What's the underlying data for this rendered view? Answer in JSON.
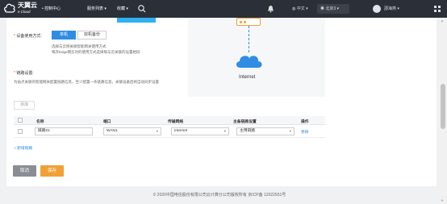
{
  "header": {
    "brand": "天翼云",
    "brand_sub": "e Cloud",
    "console": "控制中心",
    "services": "服务列表",
    "favorites": "收藏",
    "language": "中文",
    "region": "北京3",
    "username": "邵海燕"
  },
  "form": {
    "mode_label": "设备使用方式:",
    "mode_options": [
      "单机",
      "双机备份"
    ],
    "mode_selected": "单机",
    "mode_help_1": "选择与云侧关联智能网关使用方式",
    "mode_help_2": "每开Edge网云对的使用方式选择每与云关联的设置相同",
    "link_label": "链路设置:",
    "link_help": "为站点关联的智能网关配置链路信息，至少配置一条链路信息，关联设备后将自动同步设置"
  },
  "topology": {
    "internet_label": "Internet"
  },
  "table": {
    "add_button": "添加",
    "columns": [
      "名称",
      "端口",
      "传输网络",
      "主备链路设置",
      "操作"
    ],
    "rows": [
      {
        "name": "链路01",
        "port": "WAN1",
        "network": "Internet",
        "role": "主用链路",
        "action": "移除"
      }
    ],
    "new_link": "+ 新增链路"
  },
  "actions": {
    "cancel": "取消",
    "save": "保存"
  },
  "footer": {
    "copyright": "© 2020中国电信股份有限公司云计算分公司版权所有 京ICP备 12022551号"
  },
  "colors": {
    "accent": "#2f8de4",
    "save": "#f0a136",
    "cancel": "#8a8d93",
    "header": "#2b2f38"
  }
}
